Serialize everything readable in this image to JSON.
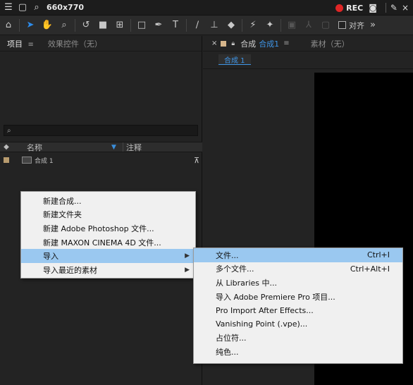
{
  "recorder": {
    "size_label": "660x770",
    "rec_label": "REC"
  },
  "toolbar": {
    "tools": [
      "home-icon",
      "selection-icon",
      "hand-icon",
      "zoom-icon",
      "rotate-icon",
      "camera-icon",
      "pan-behind-icon",
      "rectangle-icon",
      "pen-icon",
      "type-icon",
      "brush-icon",
      "clone-stamp-icon",
      "eraser-icon",
      "roto-brush-icon",
      "puppet-pin-icon"
    ],
    "snap_label": "对齐"
  },
  "project_panel": {
    "tab_project": "项目",
    "tab_effects": "效果控件（无）",
    "search_icon": "⌕",
    "column_name": "名称",
    "column_note": "注释",
    "items": [
      {
        "name": "合成 1"
      }
    ]
  },
  "viewer": {
    "close_glyph": "×",
    "tab_prefix": "合成",
    "tab_name": "合成1",
    "tab_footage": "素材（无）",
    "subtab": "合成 1"
  },
  "context_menu": {
    "items": [
      {
        "label": "新建合成..."
      },
      {
        "label": "新建文件夹"
      },
      {
        "label": "新建 Adobe Photoshop 文件..."
      },
      {
        "label": "新建 MAXON CINEMA 4D 文件..."
      },
      {
        "label": "导入",
        "submenu": true,
        "highlighted": true
      },
      {
        "label": "导入最近的素材",
        "submenu": true
      }
    ]
  },
  "import_submenu": {
    "items": [
      {
        "label": "文件...",
        "shortcut": "Ctrl+I",
        "highlighted": true
      },
      {
        "label": "多个文件...",
        "shortcut": "Ctrl+Alt+I"
      },
      {
        "label": "从 Libraries 中..."
      },
      {
        "label": "导入 Adobe Premiere Pro 项目..."
      },
      {
        "label": "Pro Import After Effects..."
      },
      {
        "label": "Vanishing Point (.vpe)..."
      },
      {
        "label": "占位符..."
      },
      {
        "label": "纯色..."
      }
    ]
  },
  "colors": {
    "accent": "#2d8ceb",
    "highlight": "#9ac8f0",
    "rec": "#e02626"
  }
}
